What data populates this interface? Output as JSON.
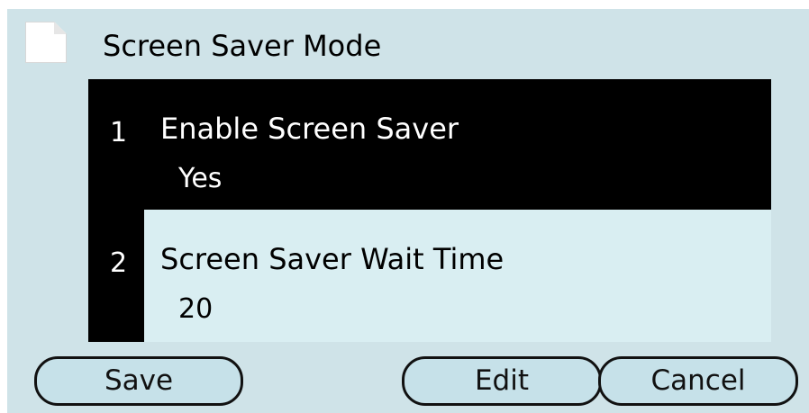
{
  "title": "Screen Saver Mode",
  "items": [
    {
      "number": "1",
      "label": "Enable Screen Saver",
      "value": "Yes"
    },
    {
      "number": "2",
      "label": "Screen Saver Wait Time",
      "value": "20"
    }
  ],
  "softkeys": {
    "save": "Save",
    "edit": "Edit",
    "cancel": "Cancel"
  },
  "colors": {
    "screen_bg": "#cfe3e8",
    "selected_bg": "#000000",
    "item_bg": "#d9eef2",
    "button_bg": "#c6e1e9"
  },
  "icons": {
    "title_icon": "document-icon"
  }
}
